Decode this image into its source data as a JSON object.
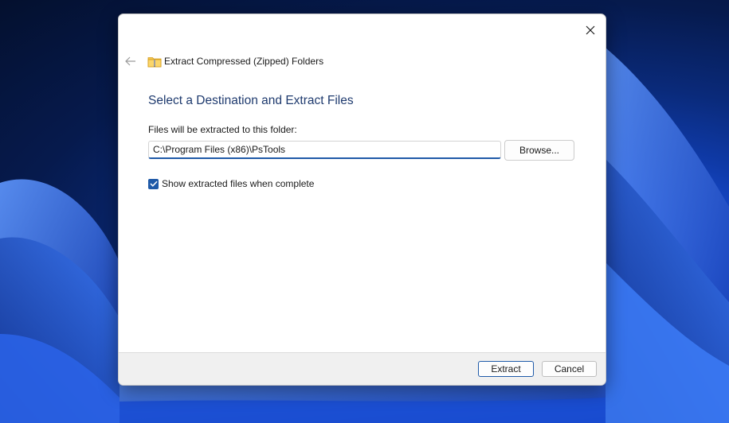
{
  "window": {
    "title": "Extract Compressed (Zipped) Folders",
    "close_icon": "close-icon",
    "back_icon": "back-arrow-icon",
    "folder_icon": "zipped-folder-icon"
  },
  "main": {
    "heading": "Select a Destination and Extract Files",
    "destination_label": "Files will be extracted to this folder:",
    "destination_value": "C:\\Program Files (x86)\\PsTools",
    "browse_label": "Browse...",
    "show_files_label": "Show extracted files when complete",
    "show_files_checked": true
  },
  "footer": {
    "extract_label": "Extract",
    "cancel_label": "Cancel"
  },
  "colors": {
    "accent": "#1f5aa8",
    "heading": "#1e3a6e"
  }
}
